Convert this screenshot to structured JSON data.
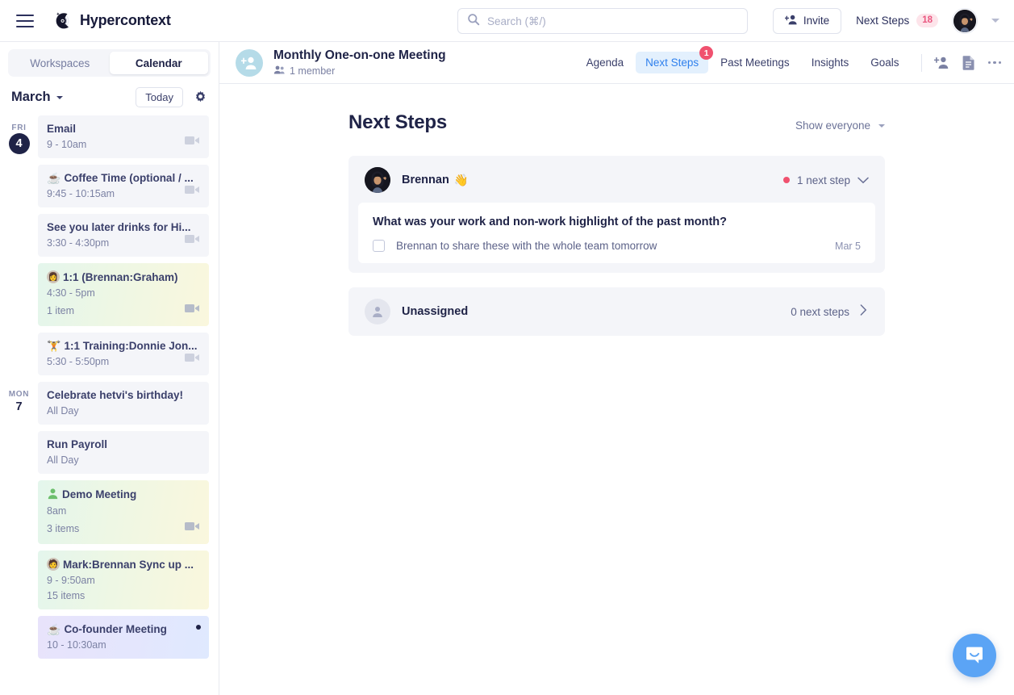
{
  "topbar": {
    "brand": "Hypercontext",
    "search_placeholder": "Search (⌘/)",
    "search_value": "",
    "invite_label": "Invite",
    "next_steps_label": "Next Steps",
    "next_steps_count": "18"
  },
  "sidebar": {
    "tabs": [
      {
        "label": "Workspaces",
        "active": false
      },
      {
        "label": "Calendar",
        "active": true
      }
    ],
    "month": "March",
    "today_label": "Today",
    "days": [
      {
        "dow": "FRI",
        "dnum": "4",
        "today": true,
        "events": [
          {
            "emoji": "",
            "avatar": "",
            "title": "Email",
            "time": "9 - 10am",
            "items": "",
            "cam": true,
            "style": "plain",
            "dot": false
          },
          {
            "emoji": "☕",
            "avatar": "",
            "title": "Coffee Time (optional / ...",
            "time": "9:45 - 10:15am",
            "items": "",
            "cam": true,
            "style": "plain",
            "dot": false
          },
          {
            "emoji": "",
            "avatar": "",
            "title": "See you later drinks for Hi...",
            "time": "3:30 - 4:30pm",
            "items": "",
            "cam": true,
            "style": "plain",
            "dot": false
          },
          {
            "emoji": "",
            "avatar": "👩",
            "title": "1:1 (Brennan:Graham)",
            "time": "4:30 - 5pm",
            "items": "1 item",
            "cam": true,
            "style": "grad-green",
            "dot": false
          },
          {
            "emoji": "🏋️",
            "avatar": "",
            "title": "1:1 Training:Donnie Jon...",
            "time": "5:30 - 5:50pm",
            "items": "",
            "cam": true,
            "style": "plain",
            "dot": false
          }
        ]
      },
      {
        "dow": "MON",
        "dnum": "7",
        "today": false,
        "events": [
          {
            "emoji": "",
            "avatar": "",
            "title": "Celebrate hetvi's birthday!",
            "time": "All Day",
            "items": "",
            "cam": false,
            "style": "plain",
            "dot": false
          },
          {
            "emoji": "",
            "avatar": "",
            "title": "Run Payroll",
            "time": "All Day",
            "items": "",
            "cam": false,
            "style": "plain",
            "dot": false
          },
          {
            "emoji": "👤",
            "avatar": "",
            "title": "Demo Meeting",
            "time": "8am",
            "items": "3 items",
            "cam": true,
            "style": "grad-green",
            "dot": false
          },
          {
            "emoji": "",
            "avatar": "🧑",
            "title": "Mark:Brennan Sync up ...",
            "time": "9 - 9:50am",
            "items": "15 items",
            "cam": false,
            "style": "grad-green",
            "dot": false
          },
          {
            "emoji": "☕",
            "avatar": "",
            "title": "Co-founder Meeting",
            "time": "10 - 10:30am",
            "items": "",
            "cam": false,
            "style": "grad-purple",
            "dot": true
          }
        ]
      }
    ]
  },
  "meeting": {
    "title": "Monthly One-on-one Meeting",
    "member_count": "1 member",
    "tabs": [
      {
        "label": "Agenda",
        "active": false,
        "badge": ""
      },
      {
        "label": "Next Steps",
        "active": true,
        "badge": "1"
      },
      {
        "label": "Past Meetings",
        "active": false,
        "badge": ""
      },
      {
        "label": "Insights",
        "active": false,
        "badge": ""
      },
      {
        "label": "Goals",
        "active": false,
        "badge": ""
      }
    ]
  },
  "main": {
    "page_title": "Next Steps",
    "filter_label": "Show everyone",
    "person": {
      "name": "Brennan",
      "emoji": "👋",
      "steps_label": "1 next step",
      "task_question": "What was your work and non-work highlight of the past month?",
      "task_text": "Brennan to share these with the whole team tomorrow",
      "task_date": "Mar 5"
    },
    "unassigned": {
      "name": "Unassigned",
      "steps_label": "0 next steps"
    }
  },
  "colors": {
    "accent_blue": "#2f80ed",
    "badge_red": "#f0516f",
    "badge_pink_bg": "#fde4ea",
    "badge_pink_text": "#e9567f",
    "intercom_blue": "#5ba4f5",
    "text_dark": "#1f2347"
  }
}
